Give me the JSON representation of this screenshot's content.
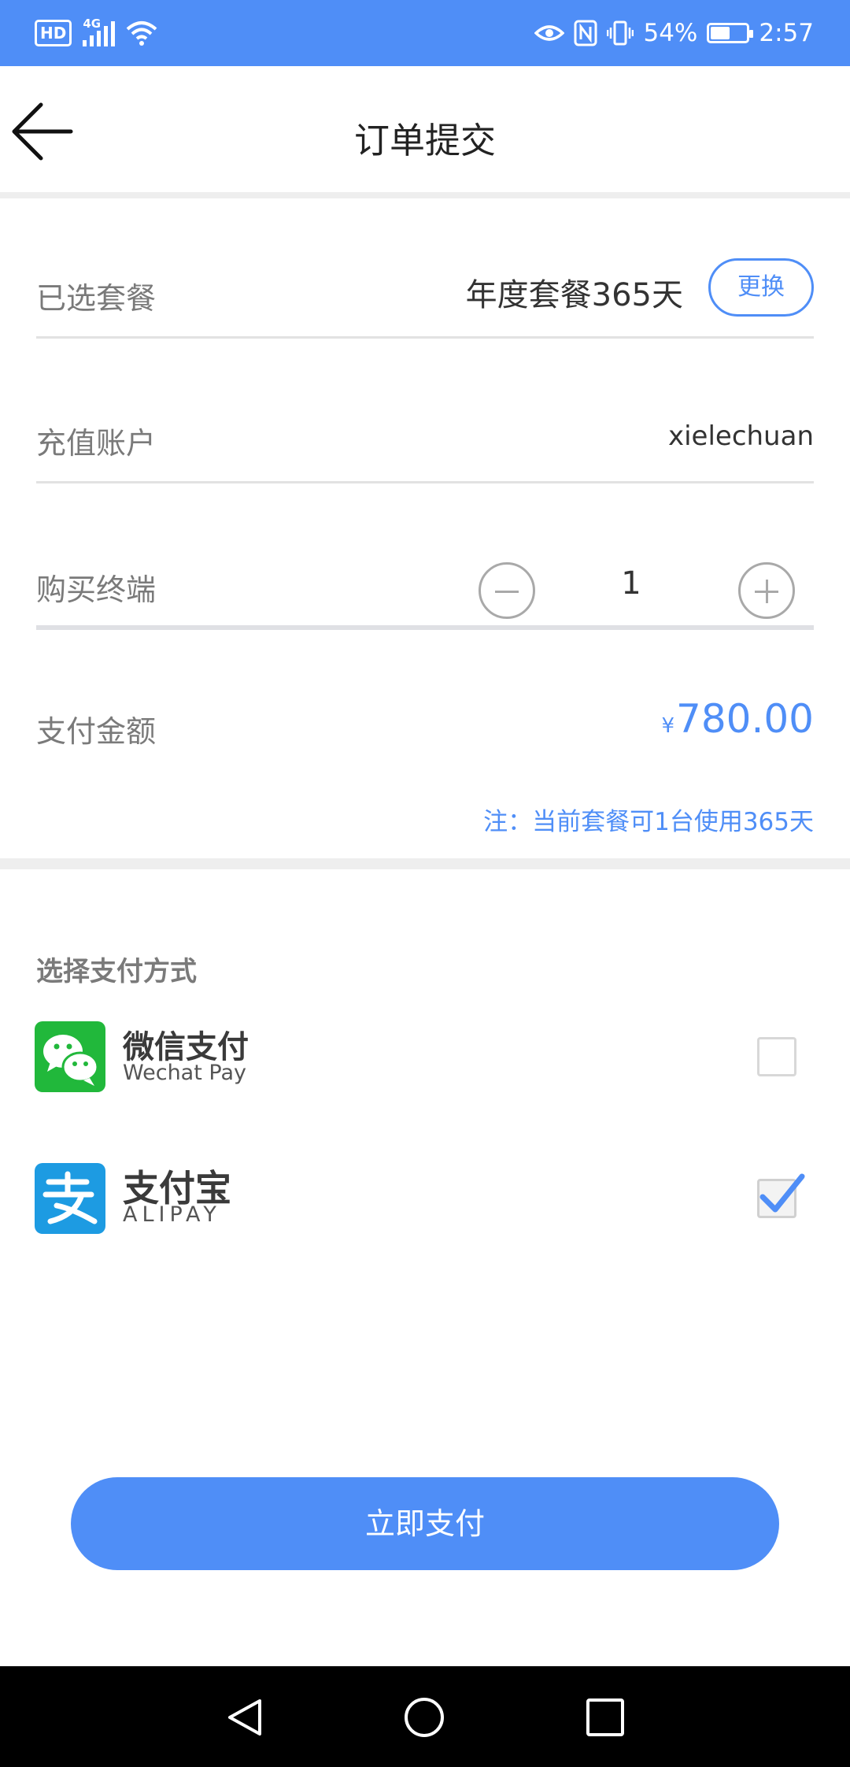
{
  "status_bar": {
    "hd": "HD",
    "network": "4G",
    "battery_text": "54%",
    "battery_level": 0.54,
    "time": "2:57",
    "icons": [
      "eye-icon",
      "nfc-icon",
      "vibrate-icon",
      "battery-icon",
      "wifi-icon",
      "signal-icon"
    ]
  },
  "header": {
    "title": "订单提交",
    "back_icon": "arrow-left-icon"
  },
  "order": {
    "plan_label": "已选套餐",
    "plan_value": "年度套餐365天",
    "change_label": "更换",
    "account_label": "充值账户",
    "account_value": "xielechuan",
    "terminal_label": "购买终端",
    "quantity": "1",
    "amount_label": "支付金额",
    "currency": "¥",
    "amount": "780.00",
    "note": "注：当前套餐可1台使用365天"
  },
  "payment": {
    "section_title": "选择支付方式",
    "options": [
      {
        "name_cn": "微信支付",
        "name_en": "Wechat Pay",
        "checked": false
      },
      {
        "name_cn": "支付宝",
        "name_en": "ALIPAY",
        "checked": true
      }
    ],
    "submit_label": "立即支付"
  },
  "colors": {
    "accent": "#4f8ef7",
    "wechat": "#21b83b",
    "alipay": "#1d9be2"
  }
}
